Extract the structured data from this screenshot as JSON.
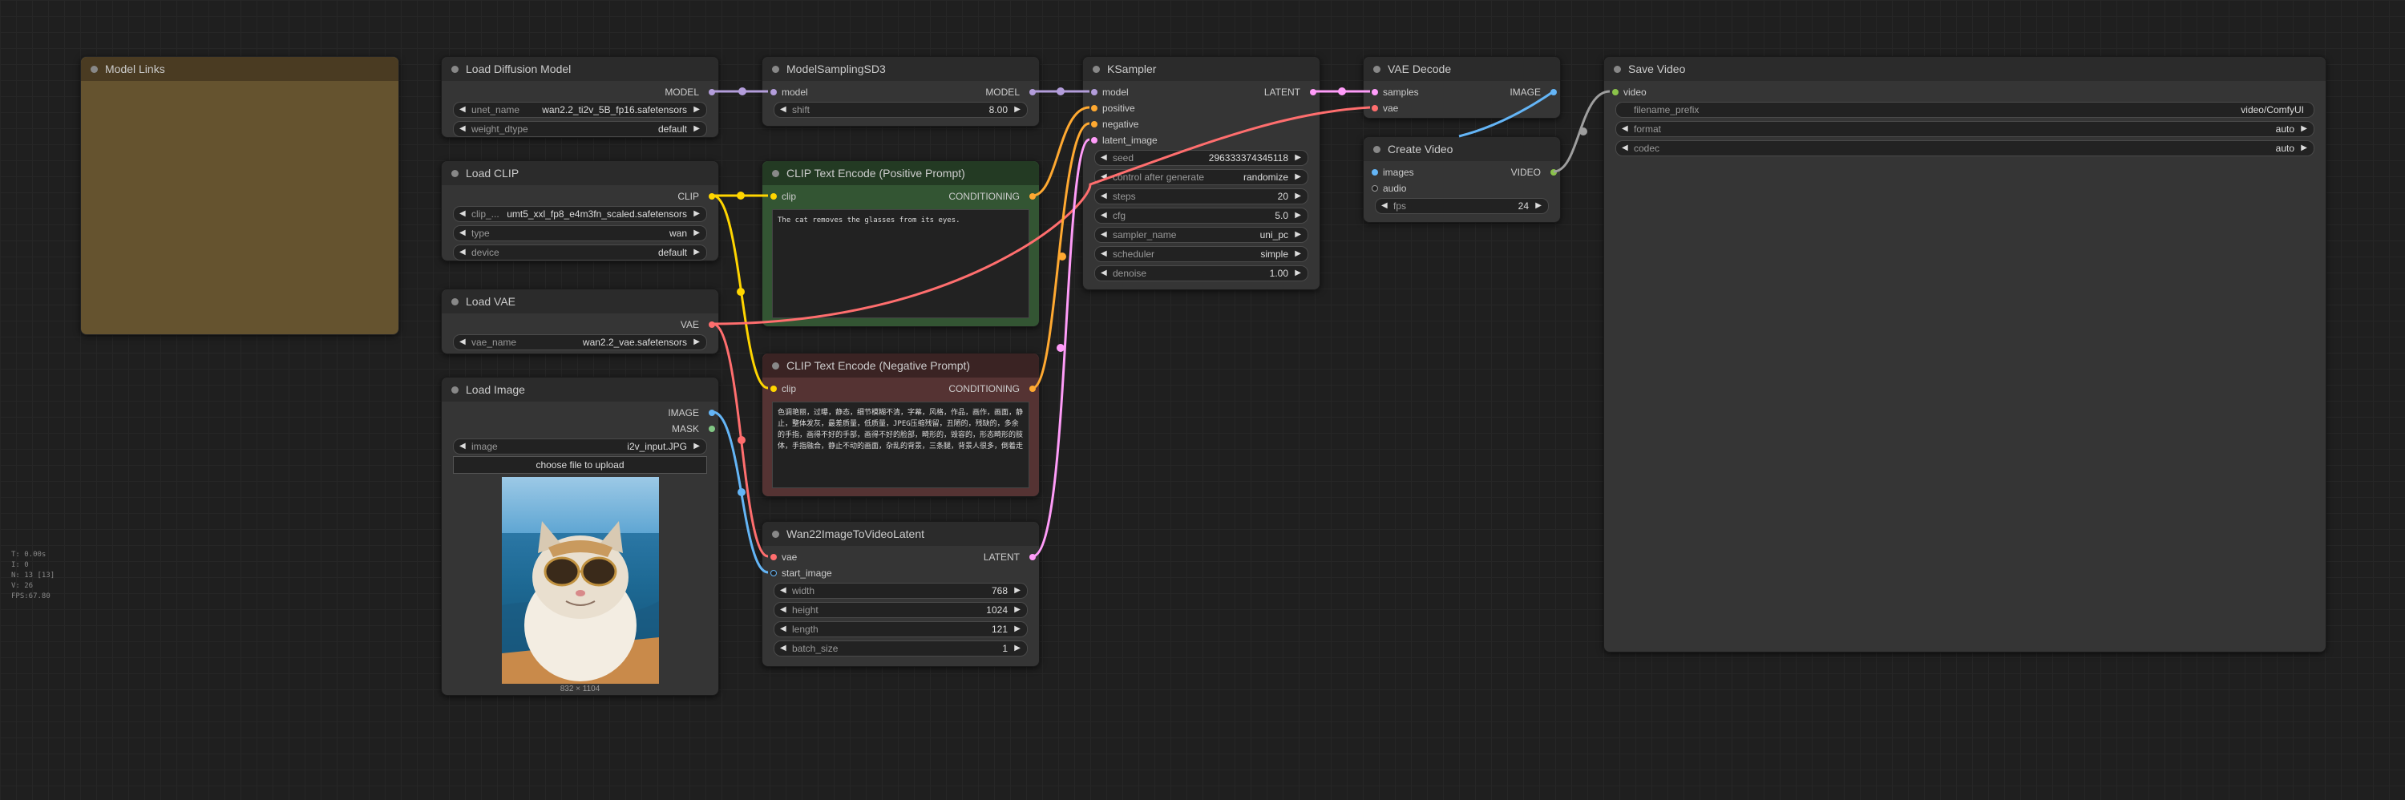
{
  "nodes": {
    "model_links": {
      "title": "Model Links"
    },
    "load_diffusion_model": {
      "title": "Load Diffusion Model",
      "output": "MODEL",
      "unet_name_label": "unet_name",
      "unet_name": "wan2.2_ti2v_5B_fp16.safetensors",
      "weight_dtype_label": "weight_dtype",
      "weight_dtype": "default"
    },
    "load_clip": {
      "title": "Load CLIP",
      "output": "CLIP",
      "clip_name_label": "clip_...",
      "clip_name": "umt5_xxl_fp8_e4m3fn_scaled.safetensors",
      "type_label": "type",
      "type": "wan",
      "device_label": "device",
      "device": "default"
    },
    "load_vae": {
      "title": "Load VAE",
      "output": "VAE",
      "vae_name_label": "vae_name",
      "vae_name": "wan2.2_vae.safetensors"
    },
    "load_image": {
      "title": "Load Image",
      "output_image": "IMAGE",
      "output_mask": "MASK",
      "image_label": "image",
      "image": "i2v_input.JPG",
      "upload": "choose file to upload",
      "size": "832 × 1104"
    },
    "model_sampling": {
      "title": "ModelSamplingSD3",
      "input": "model",
      "output": "MODEL",
      "shift_label": "shift",
      "shift": "8.00"
    },
    "clip_pos": {
      "title": "CLIP Text Encode (Positive Prompt)",
      "input": "clip",
      "output": "CONDITIONING",
      "text": "The cat removes the glasses from its eyes."
    },
    "clip_neg": {
      "title": "CLIP Text Encode (Negative Prompt)",
      "input": "clip",
      "output": "CONDITIONING",
      "text": "色调艳丽，过曝，静态，细节模糊不清，字幕，风格，作品，画作，画面，静止，整体发灰，最差质量，低质量，JPEG压缩残留，丑陋的，残缺的，多余的手指，画得不好的手部，画得不好的脸部，畸形的，毁容的，形态畸形的肢体，手指融合，静止不动的画面，杂乱的背景，三条腿，背景人很多，倒着走"
    },
    "wan22": {
      "title": "Wan22ImageToVideoLatent",
      "input_vae": "vae",
      "input_start": "start_image",
      "output": "LATENT",
      "width_label": "width",
      "width": "768",
      "height_label": "height",
      "height": "1024",
      "length_label": "length",
      "length": "121",
      "batch_label": "batch_size",
      "batch": "1"
    },
    "ksampler": {
      "title": "KSampler",
      "in_model": "model",
      "in_pos": "positive",
      "in_neg": "negative",
      "in_latent": "latent_image",
      "output": "LATENT",
      "seed_label": "seed",
      "seed": "296333374345118",
      "control_label": "control after generate",
      "control": "randomize",
      "steps_label": "steps",
      "steps": "20",
      "cfg_label": "cfg",
      "cfg": "5.0",
      "sampler_label": "sampler_name",
      "sampler": "uni_pc",
      "scheduler_label": "scheduler",
      "scheduler": "simple",
      "denoise_label": "denoise",
      "denoise": "1.00"
    },
    "vae_decode": {
      "title": "VAE Decode",
      "in_samples": "samples",
      "in_vae": "vae",
      "output": "IMAGE"
    },
    "create_video": {
      "title": "Create Video",
      "in_images": "images",
      "in_audio": "audio",
      "output": "VIDEO",
      "fps_label": "fps",
      "fps": "24"
    },
    "save_video": {
      "title": "Save Video",
      "input": "video",
      "prefix_label": "filename_prefix",
      "prefix": "video/ComfyUI",
      "format_label": "format",
      "format": "auto",
      "codec_label": "codec",
      "codec": "auto"
    }
  },
  "stats": {
    "t": "T: 0.00s",
    "i": "I: 0",
    "n": "N: 13 [13]",
    "v": "V: 26",
    "fps": "FPS:67.80"
  },
  "colors": {
    "model": "#b39ddb",
    "clip": "#ffd500",
    "vae": "#ff6e6e",
    "conditioning": "#ffa931",
    "latent": "#ff9cf9",
    "image": "#64b5f6",
    "video": "#8bc34a"
  }
}
